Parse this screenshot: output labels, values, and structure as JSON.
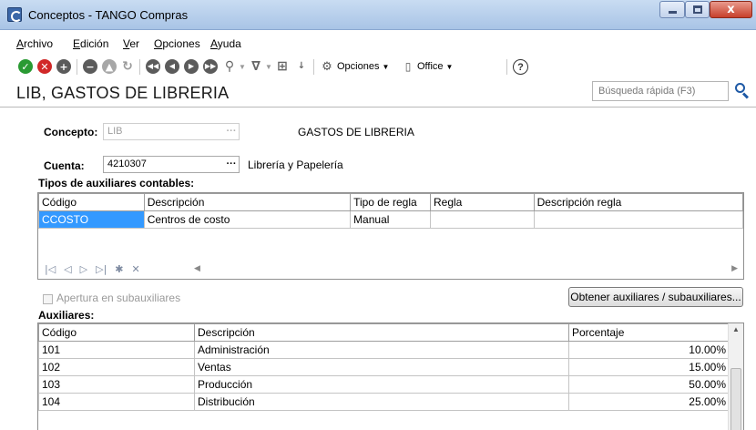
{
  "window": {
    "title": "Conceptos - TANGO Compras",
    "min_glyph": "",
    "close_glyph": "x"
  },
  "menu": [
    "Archivo",
    "Edición",
    "Ver",
    "Opciones",
    "Ayuda"
  ],
  "toolbar": {
    "options_label": "Opciones",
    "office_label": "Office",
    "help_glyph": "?"
  },
  "header": {
    "page_title": "LIB, GASTOS DE LIBRERIA",
    "search_placeholder": "Búsqueda rápida (F3)"
  },
  "form": {
    "concepto_label": "Concepto:",
    "concepto_code": "LIB",
    "concepto_description": "GASTOS DE LIBRERIA",
    "cuenta_label": "Cuenta:",
    "cuenta_value": "4210307",
    "cuenta_description": "Librería y Papelería",
    "lookup_glyph": "···"
  },
  "tipos_auxiliares": {
    "section_label": "Tipos de auxiliares contables:",
    "columns": [
      "Código",
      "Descripción",
      "Tipo de regla",
      "Regla",
      "Descripción regla"
    ],
    "rows": [
      {
        "codigo": "CCOSTO",
        "descripcion": "Centros de costo",
        "tipo_regla": "Manual",
        "regla": "",
        "descripcion_regla": ""
      }
    ],
    "nav_icons": [
      "first-icon",
      "prev-icon",
      "next-icon",
      "last-icon",
      "new-record-icon",
      "delete-icon"
    ]
  },
  "apertura": {
    "label": "Apertura en subauxiliares",
    "checked": false
  },
  "obtener_button": "Obtener auxiliares / subauxiliares...",
  "auxiliares": {
    "section_label": "Auxiliares:",
    "columns": [
      "Código",
      "Descripción",
      "Porcentaje"
    ],
    "rows": [
      {
        "codigo": "101",
        "descripcion": "Administración",
        "porcentaje": "10.00%"
      },
      {
        "codigo": "102",
        "descripcion": "Ventas",
        "porcentaje": "15.00%"
      },
      {
        "codigo": "103",
        "descripcion": "Producción",
        "porcentaje": "50.00%"
      },
      {
        "codigo": "104",
        "descripcion": "Distribución",
        "porcentaje": "25.00%"
      }
    ]
  },
  "colors": {
    "selection": "#3399ff",
    "accept_icon": "#2a9a33",
    "cancel_icon": "#d12828",
    "search_icon": "#1f5aa6"
  }
}
